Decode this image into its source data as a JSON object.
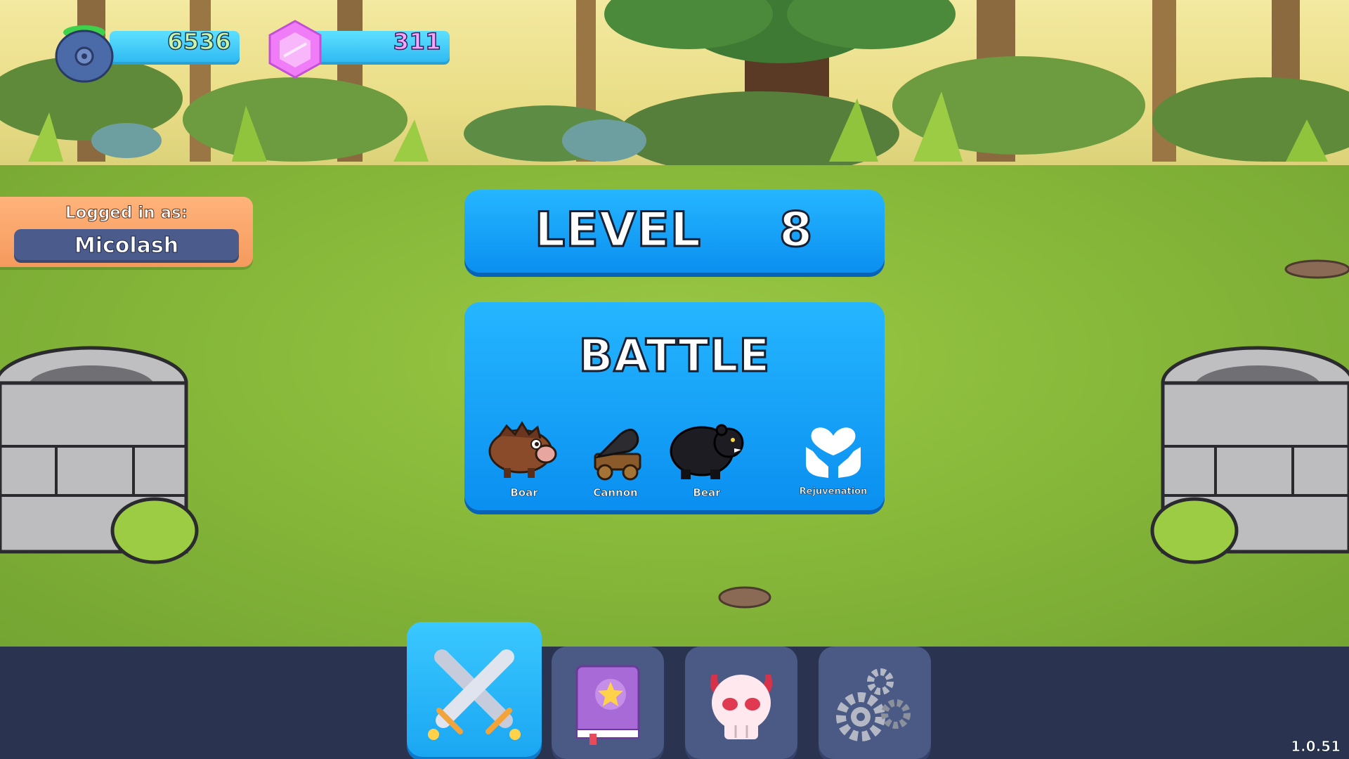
{
  "resources": {
    "gold": {
      "icon": "cauldron-icon",
      "value": "6536"
    },
    "gems": {
      "icon": "gem-icon",
      "value": "311"
    }
  },
  "login": {
    "label": "Logged in as:",
    "username": "Micolash"
  },
  "level": {
    "label": "LEVEL",
    "number": "8"
  },
  "battle": {
    "title": "BATTLE",
    "units": [
      {
        "name": "Boar",
        "icon": "boar-icon"
      },
      {
        "name": "Cannon",
        "icon": "cannon-icon"
      },
      {
        "name": "Bear",
        "icon": "bear-icon"
      },
      {
        "name": "Rejuvenation",
        "icon": "heart-hands-icon"
      }
    ]
  },
  "nav": {
    "items": [
      {
        "icon": "crossed-swords-icon",
        "active": true
      },
      {
        "icon": "star-book-icon",
        "active": false
      },
      {
        "icon": "devil-skull-icon",
        "active": false
      },
      {
        "icon": "gears-icon",
        "active": false
      }
    ]
  },
  "version": "1.0.51",
  "colors": {
    "panel_blue": "#0a8ff0",
    "login_orange": "#f59a5e",
    "nav_bg": "#2a3450",
    "nav_button": "#4a5a84",
    "grass": "#88b93a"
  }
}
